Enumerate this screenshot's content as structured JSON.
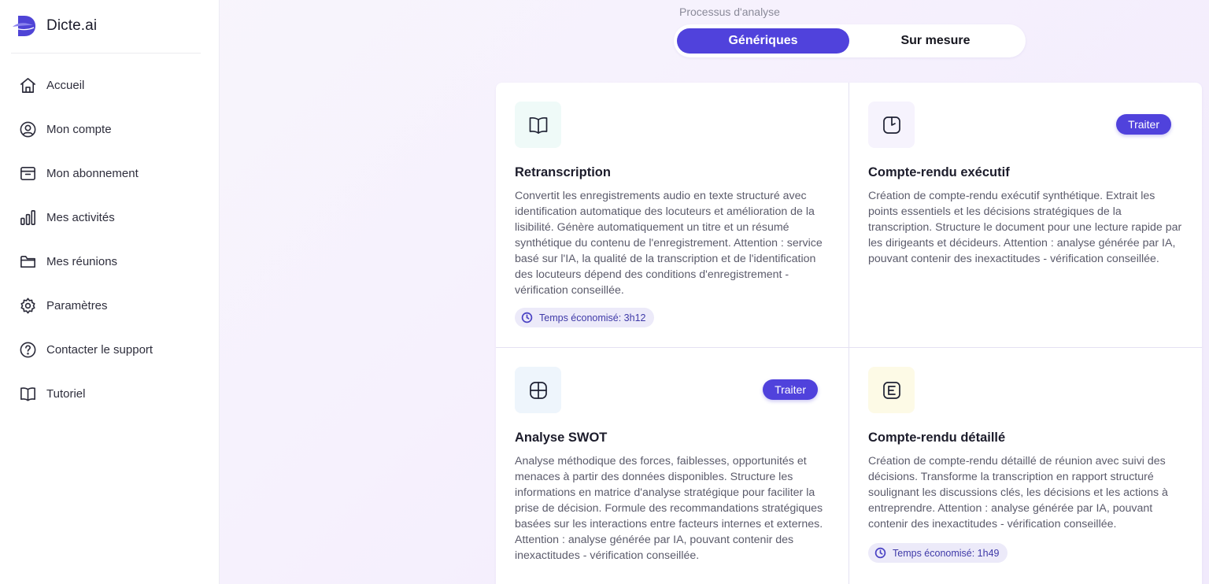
{
  "brand": {
    "name": "Dicte.ai"
  },
  "sidebar": {
    "items": [
      {
        "label": "Accueil",
        "icon": "home-icon"
      },
      {
        "label": "Mon compte",
        "icon": "user-circle-icon"
      },
      {
        "label": "Mon abonnement",
        "icon": "archive-box-icon"
      },
      {
        "label": "Mes activités",
        "icon": "bar-chart-icon"
      },
      {
        "label": "Mes réunions",
        "icon": "folder-icon"
      },
      {
        "label": "Paramètres",
        "icon": "gear-icon"
      },
      {
        "label": "Contacter le support",
        "icon": "help-circle-icon"
      },
      {
        "label": "Tutoriel",
        "icon": "book-open-icon"
      }
    ]
  },
  "process": {
    "caption": "Processus d'analyse",
    "tabs": [
      {
        "label": "Génériques",
        "active": true
      },
      {
        "label": "Sur mesure",
        "active": false
      }
    ]
  },
  "cards": [
    {
      "title": "Retranscription",
      "icon": "book-open-icon",
      "description": "Convertit les enregistrements audio en texte structuré avec identification automatique des locuteurs et amélioration de la lisibilité. Génère automatiquement un titre et un résumé synthétique du contenu de l'enregistrement. Attention : service basé sur l'IA, la qualité de la transcription et de l'identification des locuteurs dépend des conditions d'enregistrement - vérification conseillée.",
      "time_saved": "Temps économisé: 3h12"
    },
    {
      "title": "Compte-rendu exécutif",
      "icon": "clock-square-icon",
      "description": "Création de compte-rendu exécutif synthétique. Extrait les points essentiels et les décisions stratégiques de la transcription. Structure le document pour une lecture rapide par les dirigeants et décideurs. Attention : analyse générée par IA, pouvant contenir des inexactitudes - vérification conseillée.",
      "action": "Traiter"
    },
    {
      "title": "Analyse SWOT",
      "icon": "grid-quadrant-icon",
      "description": "Analyse méthodique des forces, faiblesses, opportunités et menaces à partir des données disponibles. Structure les informations en matrice d'analyse stratégique pour faciliter la prise de décision. Formule des recommandations stratégiques basées sur les interactions entre facteurs internes et externes. Attention : analyse générée par IA, pouvant contenir des inexactitudes - vérification conseillée.",
      "action": "Traiter"
    },
    {
      "title": "Compte-rendu détaillé",
      "icon": "document-lines-icon",
      "description": "Création de compte-rendu détaillé de réunion avec suivi des décisions. Transforme la transcription en rapport structuré soulignant les discussions clés, les décisions et les actions à entreprendre. Attention : analyse générée par IA, pouvant contenir des inexactitudes - vérification conseillée.",
      "time_saved": "Temps économisé: 1h49"
    }
  ],
  "colors": {
    "accent": "#5042dc",
    "badge_bg": "#eceaf9"
  }
}
